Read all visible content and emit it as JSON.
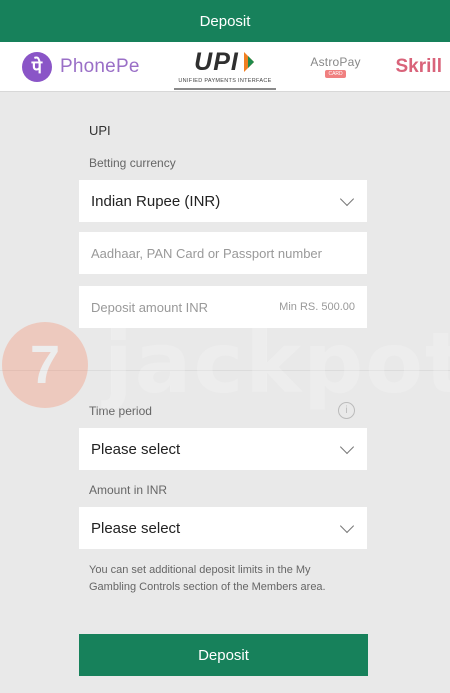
{
  "header": {
    "title": "Deposit"
  },
  "methods": {
    "phonepe_logo_glyph": "पे",
    "phonepe": "PhonePe",
    "upi": "UPI",
    "upi_subtitle": "UNIFIED PAYMENTS INTERFACE",
    "astropay": "AstroPay",
    "astropay_badge": "CARD",
    "skrill": "Skrill"
  },
  "form": {
    "section_title": "UPI",
    "currency_label": "Betting currency",
    "currency_value": "Indian Rupee (INR)",
    "id_placeholder": "Aadhaar, PAN Card or Passport number",
    "amount_placeholder": "Deposit amount INR",
    "amount_min": "Min RS. 500.00",
    "time_period_label": "Time period",
    "time_period_value": "Please select",
    "amount_inr_label": "Amount in INR",
    "amount_inr_value": "Please select",
    "info_text": "You can set additional deposit limits in the My Gambling Controls section of the Members area.",
    "deposit_button": "Deposit"
  },
  "watermark": {
    "text": "jackpots",
    "badge": "7"
  },
  "colors": {
    "brand": "#17815b",
    "background": "#e9e9e9",
    "phonepe": "#8a55c7",
    "skrill": "#d9637a"
  }
}
